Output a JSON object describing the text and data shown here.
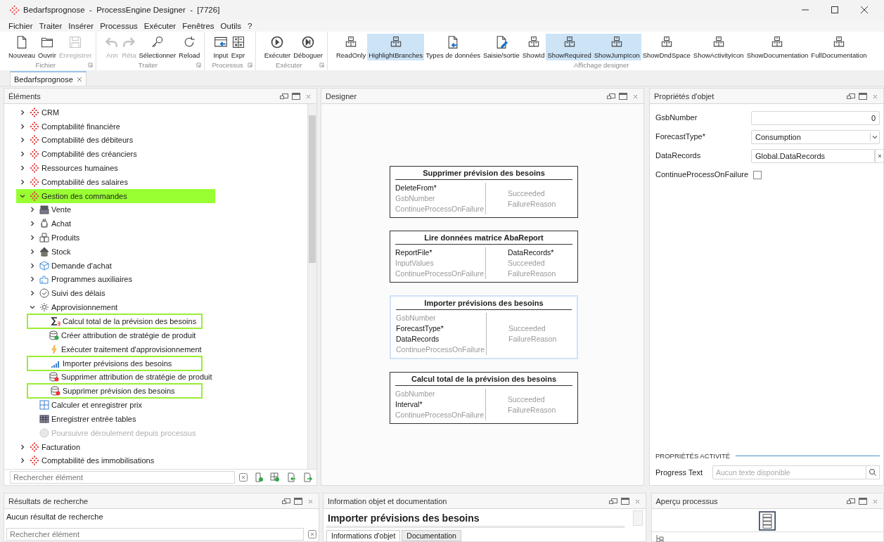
{
  "window": {
    "title": "Bedarfsprognose  -  ProcessEngine Designer  -  [7726]"
  },
  "menu": [
    "Fichier",
    "Traiter",
    "Insérer",
    "Processus",
    "Exécuter",
    "Fenêtres",
    "Outils",
    "?"
  ],
  "toolbar": [
    {
      "label": "Fichier",
      "launcher": true,
      "buttons": [
        {
          "label": "Nouveau",
          "disabled": false,
          "selected": false
        },
        {
          "label": "Ouvrir",
          "disabled": false,
          "selected": false
        },
        {
          "label": "Enregistrer",
          "disabled": true,
          "selected": false
        }
      ]
    },
    {
      "label": "Traiter",
      "launcher": true,
      "buttons": [
        {
          "label": "Ann",
          "disabled": true,
          "selected": false
        },
        {
          "label": "Réta",
          "disabled": true,
          "selected": false
        },
        {
          "label": "Sélectionner",
          "disabled": false,
          "selected": false
        },
        {
          "label": "Reload",
          "disabled": false,
          "selected": false
        }
      ]
    },
    {
      "label": "Processus",
      "launcher": true,
      "buttons": [
        {
          "label": "Input",
          "disabled": false,
          "selected": false
        },
        {
          "label": "Expr",
          "disabled": false,
          "selected": false
        }
      ]
    },
    {
      "label": "Exécuter",
      "launcher": true,
      "buttons": [
        {
          "label": "Exécuter",
          "disabled": false,
          "selected": false
        },
        {
          "label": "Déboguer",
          "disabled": false,
          "selected": false
        }
      ]
    },
    {
      "label": "Affichage designer",
      "launcher": false,
      "buttons": [
        {
          "label": "ReadOnly",
          "disabled": false,
          "selected": false
        },
        {
          "label": "HighlightBranches",
          "disabled": false,
          "selected": true
        },
        {
          "label": "Types de données",
          "disabled": false,
          "selected": false
        },
        {
          "label": "Saisie/sortie",
          "disabled": false,
          "selected": false
        },
        {
          "label": "ShowId",
          "disabled": false,
          "selected": false
        },
        {
          "label": "ShowRequired",
          "disabled": false,
          "selected": true
        },
        {
          "label": "ShowJumpIcon",
          "disabled": false,
          "selected": true
        },
        {
          "label": "ShowDndSpace",
          "disabled": false,
          "selected": false
        },
        {
          "label": "ShowActivityIcon",
          "disabled": false,
          "selected": false
        },
        {
          "label": "ShowDocumentation",
          "disabled": false,
          "selected": false
        },
        {
          "label": "FullDocumentation",
          "disabled": false,
          "selected": false
        }
      ]
    }
  ],
  "document_tabs": [
    {
      "label": "Bedarfsprognose",
      "selected": true
    }
  ],
  "elements": {
    "title": "Éléments",
    "search": {
      "placeholder": "Rechercher élément"
    }
  },
  "tree": {
    "items": [
      {
        "label": "CRM",
        "expanded": false,
        "selected": false,
        "outlined": false,
        "disabled": false
      },
      {
        "label": "Comptabilité financière",
        "expanded": false,
        "selected": false,
        "outlined": false,
        "disabled": false
      },
      {
        "label": "Comptabilité des débiteurs",
        "expanded": false,
        "selected": false,
        "outlined": false,
        "disabled": false
      },
      {
        "label": "Comptabilité des créanciers",
        "expanded": false,
        "selected": false,
        "outlined": false,
        "disabled": false
      },
      {
        "label": "Ressources humaines",
        "expanded": false,
        "selected": false,
        "outlined": false,
        "disabled": false
      },
      {
        "label": "Comptabilité des salaires",
        "expanded": false,
        "selected": false,
        "outlined": false,
        "disabled": false
      },
      {
        "label": "Gestion des commandes",
        "expanded": true,
        "selected": true,
        "outlined": false,
        "disabled": false,
        "children": [
          {
            "label": "Vente",
            "expanded": false,
            "selected": false,
            "outlined": false,
            "disabled": false
          },
          {
            "label": "Achat",
            "expanded": false,
            "selected": false,
            "outlined": false,
            "disabled": false
          },
          {
            "label": "Produits",
            "expanded": false,
            "selected": false,
            "outlined": false,
            "disabled": false
          },
          {
            "label": "Stock",
            "expanded": false,
            "selected": false,
            "outlined": false,
            "disabled": false
          },
          {
            "label": "Demande d'achat",
            "expanded": false,
            "selected": false,
            "outlined": false,
            "disabled": false
          },
          {
            "label": "Programmes auxiliaires",
            "expanded": false,
            "selected": false,
            "outlined": false,
            "disabled": false
          },
          {
            "label": "Suivi des délais",
            "expanded": false,
            "selected": false,
            "outlined": false,
            "disabled": false
          },
          {
            "label": "Approvisionnement",
            "expanded": true,
            "selected": false,
            "outlined": false,
            "disabled": false,
            "children": [
              {
                "label": "Calcul total de la prévision des besoins",
                "selected": false,
                "outlined": true,
                "disabled": false
              },
              {
                "label": "Créer attribution de stratégie de produit",
                "selected": false,
                "outlined": false,
                "disabled": false
              },
              {
                "label": "Exécuter traitement d'approvisionnement",
                "selected": false,
                "outlined": false,
                "disabled": false
              },
              {
                "label": "Importer prévisions des besoins",
                "selected": false,
                "outlined": true,
                "disabled": false
              },
              {
                "label": "Supprimer attribution de stratégie de produit",
                "selected": false,
                "outlined": false,
                "disabled": false
              },
              {
                "label": "Supprimer prévision des besoins",
                "selected": false,
                "outlined": true,
                "disabled": false
              }
            ]
          },
          {
            "label": "Calculer et enregistrer prix",
            "selected": false,
            "outlined": false,
            "disabled": false
          },
          {
            "label": "Enregistrer entrée tables",
            "selected": false,
            "outlined": false,
            "disabled": false
          },
          {
            "label": "Poursuivre déroulement depuis processus",
            "selected": false,
            "outlined": false,
            "disabled": true
          }
        ]
      },
      {
        "label": "Facturation",
        "expanded": false,
        "selected": false,
        "outlined": false,
        "disabled": false
      },
      {
        "label": "Comptabilité des immobilisations",
        "expanded": false,
        "selected": false,
        "outlined": false,
        "disabled": false
      }
    ]
  },
  "designer": {
    "title": "Designer",
    "activities": [
      {
        "title": "Supprimer prévision des besoins",
        "selected": false,
        "inputs": [
          {
            "name": "DeleteFrom*",
            "active": true
          },
          {
            "name": "GsbNumber",
            "active": false
          },
          {
            "name": "ContinueProcessOnFailure",
            "active": false
          }
        ],
        "outputs": [
          {
            "name": "Succeeded",
            "active": false
          },
          {
            "name": "FailureReason",
            "active": false
          }
        ]
      },
      {
        "title": "Lire données matrice AbaReport",
        "selected": false,
        "inputs": [
          {
            "name": "ReportFile*",
            "active": true
          },
          {
            "name": "InputValues",
            "active": false
          },
          {
            "name": "ContinueProcessOnFailure",
            "active": false
          }
        ],
        "outputs": [
          {
            "name": "DataRecords*",
            "active": true
          },
          {
            "name": "Succeeded",
            "active": false
          },
          {
            "name": "FailureReason",
            "active": false
          }
        ]
      },
      {
        "title": "Importer prévisions des besoins",
        "selected": true,
        "inputs": [
          {
            "name": "GsbNumber",
            "active": false
          },
          {
            "name": "ForecastType*",
            "active": true
          },
          {
            "name": "DataRecords",
            "active": true
          },
          {
            "name": "ContinueProcessOnFailure",
            "active": false
          }
        ],
        "outputs": [
          {
            "name": "Succeeded",
            "active": false
          },
          {
            "name": "FailureReason",
            "active": false
          }
        ]
      },
      {
        "title": "Calcul total de la prévision des besoins",
        "selected": false,
        "inputs": [
          {
            "name": "GsbNumber",
            "active": false
          },
          {
            "name": "Interval*",
            "active": true
          },
          {
            "name": "ContinueProcessOnFailure",
            "active": false
          }
        ],
        "outputs": [
          {
            "name": "Succeeded",
            "active": false
          },
          {
            "name": "FailureReason",
            "active": false
          }
        ]
      }
    ]
  },
  "properties": {
    "title": "Propriétés d'objet",
    "rows": [
      {
        "label": "GsbNumber",
        "kind": "number",
        "value": "0"
      },
      {
        "label": "ForecastType*",
        "kind": "select",
        "value": "Consumption"
      },
      {
        "label": "DataRecords",
        "kind": "reference",
        "value": "Global.DataRecords"
      },
      {
        "label": "ContinueProcessOnFailure",
        "kind": "checkbox",
        "checked": false
      }
    ],
    "activity": {
      "heading": "PROPRIÉTÉS ACTIVITÉ",
      "fields": [
        {
          "label": "Progress Text",
          "placeholder": "Aucun texte disponible"
        }
      ]
    }
  },
  "search_results": {
    "title": "Résultats de recherche",
    "message": "Aucun résultat de recherche",
    "search": {
      "placeholder": "Rechercher élément"
    }
  },
  "object_info": {
    "title": "Information objet et documentation",
    "heading": "Importer prévisions des besoins",
    "tabs": [
      {
        "label": "Informations d'objet",
        "selected": true
      },
      {
        "label": "Documentation",
        "selected": false
      }
    ]
  },
  "overview": {
    "title": "Aperçu processus"
  }
}
